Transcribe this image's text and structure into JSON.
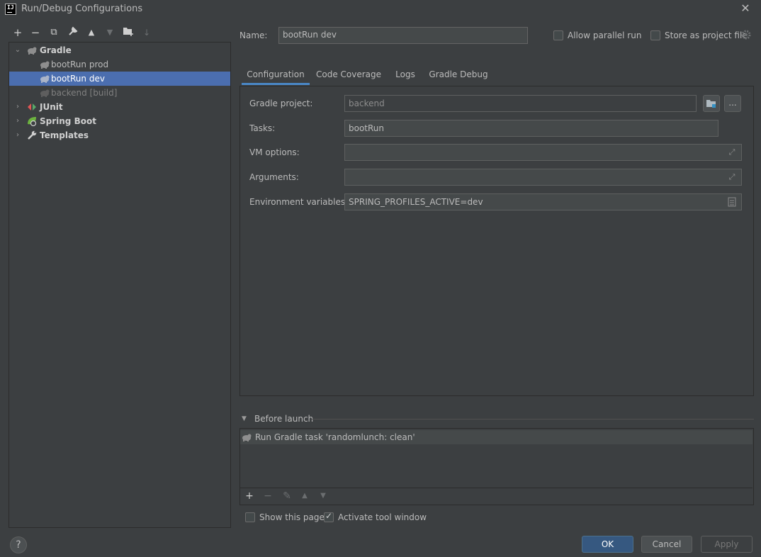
{
  "window": {
    "title": "Run/Debug Configurations",
    "app_icon_text": "IJ"
  },
  "left_toolbar": {
    "add": "+",
    "remove": "−",
    "copy": "⧉",
    "edit_templates": "🔧",
    "move_up": "▲",
    "move_down": "▼",
    "new_folder": "▆",
    "sort": "↓"
  },
  "tree": {
    "gradle": {
      "label": "Gradle",
      "children": [
        {
          "label": "bootRun prod"
        },
        {
          "label": "bootRun dev"
        },
        {
          "label": "backend [build]"
        }
      ]
    },
    "junit": {
      "label": "JUnit"
    },
    "spring_boot": {
      "label": "Spring Boot"
    },
    "templates": {
      "label": "Templates"
    }
  },
  "name_row": {
    "label": "Name:",
    "value": "bootRun dev",
    "allow_parallel_run": {
      "label": "Allow parallel run",
      "checked": false
    },
    "store_as_project_file": {
      "label": "Store as project file",
      "checked": false
    }
  },
  "tabs": [
    {
      "label": "Configuration",
      "active": true
    },
    {
      "label": "Code Coverage",
      "active": false
    },
    {
      "label": "Logs",
      "active": false
    },
    {
      "label": "Gradle Debug",
      "active": false
    }
  ],
  "form": {
    "gradle_project": {
      "label": "Gradle project:",
      "value": "backend"
    },
    "browse_label": "...",
    "tasks": {
      "label": "Tasks:",
      "value": "bootRun"
    },
    "vm_options": {
      "label": "VM options:",
      "value": ""
    },
    "arguments": {
      "label": "Arguments:",
      "value": ""
    },
    "env_vars": {
      "label": "Environment variables:",
      "value": "SPRING_PROFILES_ACTIVE=dev"
    }
  },
  "before_launch": {
    "title": "Before launch",
    "tasks": [
      {
        "label": "Run Gradle task 'randomlunch: clean'"
      }
    ],
    "toolbar": {
      "add": "+",
      "remove": "−",
      "edit": "✎",
      "up": "▲",
      "down": "▼"
    }
  },
  "bottom": {
    "show_this_page": {
      "label": "Show this page",
      "checked": false
    },
    "activate_tool_window": {
      "label": "Activate tool window",
      "checked": true
    },
    "help": "?",
    "ok": "OK",
    "cancel": "Cancel",
    "apply": "Apply"
  },
  "colors": {
    "background": "#3c3f41",
    "selection": "#4b6eaf",
    "tab_underline": "#4a88c7",
    "ok_button": "#365880"
  }
}
